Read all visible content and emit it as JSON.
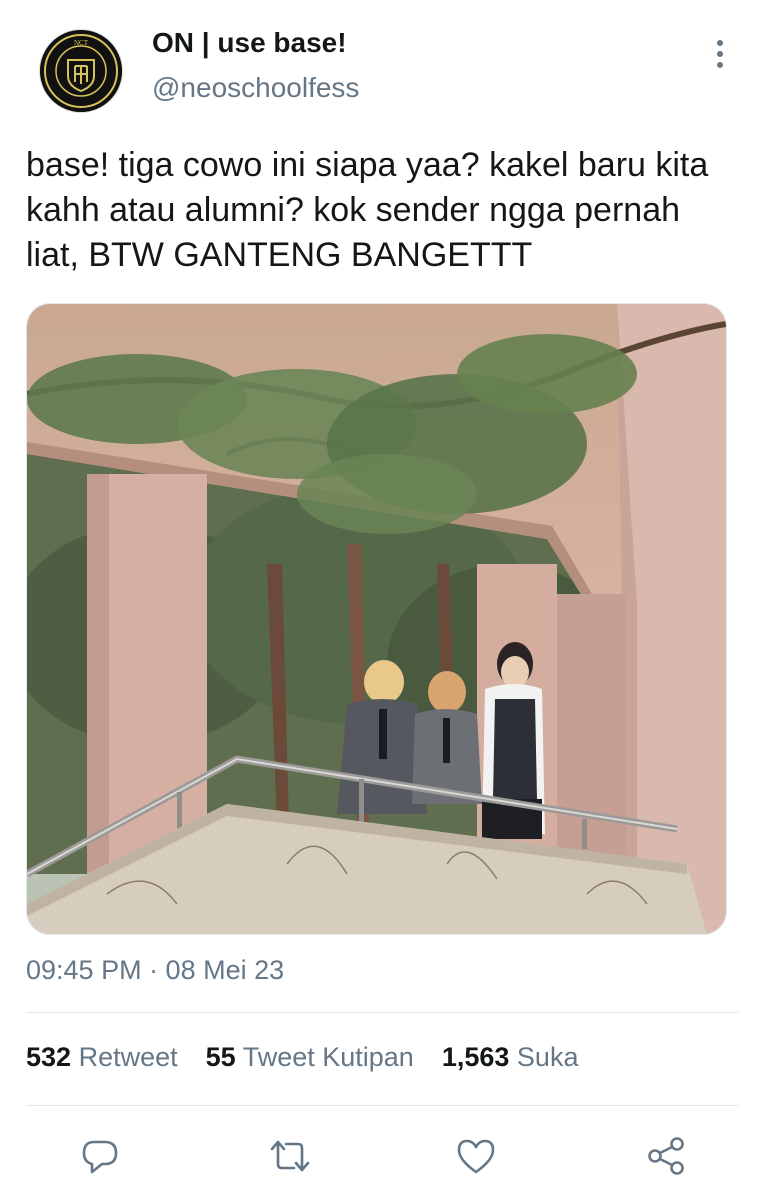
{
  "tweet": {
    "display_name": "ON | use base!",
    "handle": "@neoschoolfess",
    "avatar_icon": "nct-school-crest-icon",
    "avatar_text": "NCT",
    "avatar_ring_text": "NEO CULTURE TECHNOLOGY",
    "text": "base! tiga cowo ini siapa yaa? kakel baru kita kahh atau alumni? kok sender ngga pernah liat, BTW GANTENG BANGETTT",
    "timestamp": "09:45 PM · 08 Mei 23"
  },
  "stats": {
    "retweets_count": "532",
    "retweets_label": "Retweet",
    "quotes_count": "55",
    "quotes_label": "Tweet Kutipan",
    "likes_count": "1,563",
    "likes_label": "Suka"
  },
  "actions": {
    "reply_icon": "reply-icon",
    "retweet_icon": "retweet-icon",
    "like_icon": "heart-icon",
    "share_icon": "share-icon"
  },
  "colors": {
    "text_primary": "#14171a",
    "text_secondary": "#657786",
    "divider": "#e1e8ed",
    "crest_gold": "#d8c25a"
  }
}
